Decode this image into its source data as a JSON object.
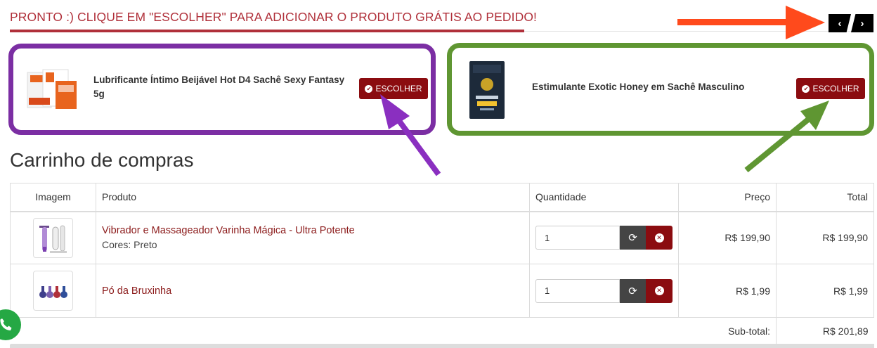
{
  "promo": {
    "title": "PRONTO :) CLIQUE EM \"ESCOLHER\" PARA ADICIONAR O PRODUTO GRÁTIS AO PEDIDO!",
    "prev_icon": "chevron-left-icon",
    "next_icon": "chevron-right-icon",
    "prev_label": "‹",
    "next_label": "›"
  },
  "gifts": [
    {
      "name": "Lubrificante Íntimo Beijável Hot D4 Sachê Sexy Fantasy 5g",
      "button_label": "ESCOLHER",
      "frame_color": "#7b2ea3"
    },
    {
      "name": "Estimulante Exotic Honey em Sachê Masculino",
      "button_label": "ESCOLHER",
      "frame_color": "#5f9632"
    }
  ],
  "cart": {
    "title": "Carrinho de compras",
    "columns": [
      "Imagem",
      "Produto",
      "Quantidade",
      "Preço",
      "Total"
    ],
    "rows": [
      {
        "product": "Vibrador e Massageador Varinha Mágica - Ultra Potente",
        "option": "Cores: Preto",
        "quantity": "1",
        "price": "R$ 199,90",
        "total": "R$ 199,90"
      },
      {
        "product": "Pó da Bruxinha",
        "option": "",
        "quantity": "1",
        "price": "R$ 1,99",
        "total": "R$ 1,99"
      }
    ],
    "subtotal_label": "Sub-total:",
    "subtotal_value": "R$ 201,89"
  },
  "colors": {
    "accent_red": "#8b0c10",
    "title_red": "#b0303a",
    "annot_orange": "#ff4a1c",
    "annot_purple": "#8a2fc0",
    "annot_green": "#5f9632",
    "whatsapp_green": "#25a844"
  }
}
